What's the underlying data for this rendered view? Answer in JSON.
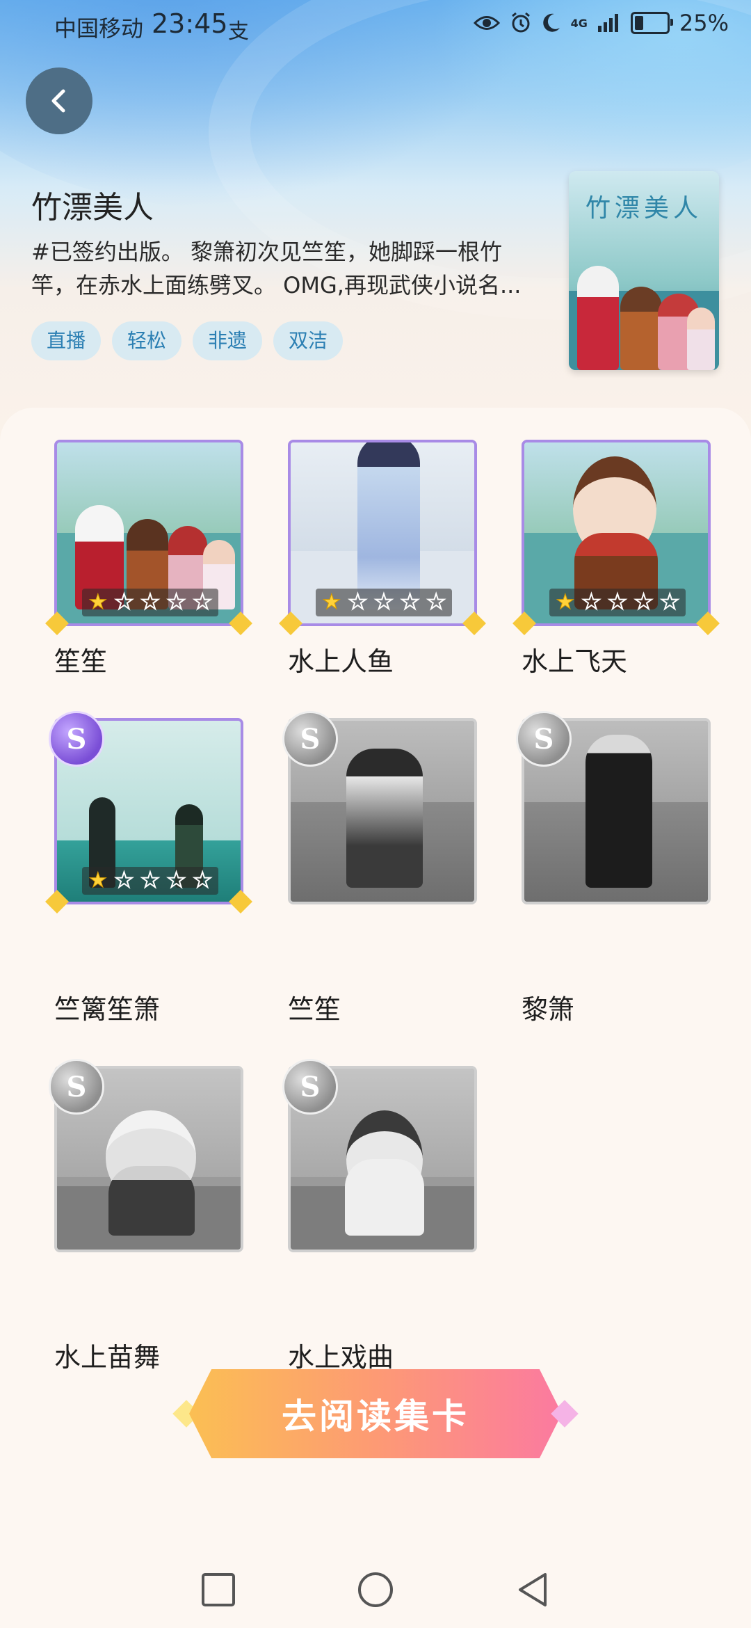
{
  "status_bar": {
    "carrier": "中国移动",
    "time": "23:45",
    "extra": "支",
    "network": "4G",
    "battery": "25%"
  },
  "book": {
    "title": "竹漂美人",
    "description_line1": "#已签约出版。 黎箫初次见竺笙，她脚踩一根竹",
    "description_line2": "竿，在赤水上面练劈叉。 OMG,再现武侠小说名...",
    "tags": [
      "直播",
      "轻松",
      "非遗",
      "双洁"
    ],
    "cover_title": "竹漂美人"
  },
  "cards": [
    {
      "name": "笙笙",
      "stars": 1,
      "collected": true
    },
    {
      "name": "水上人鱼",
      "stars": 1,
      "collected": true
    },
    {
      "name": "水上飞天",
      "stars": 1,
      "collected": true
    },
    {
      "name": "竺篱笙箫",
      "stars": 1,
      "collected": true,
      "rarity": "S"
    },
    {
      "name": "竺笙",
      "collected": false,
      "rarity": "S"
    },
    {
      "name": "黎箫",
      "collected": false,
      "rarity": "S"
    },
    {
      "name": "水上苗舞",
      "collected": false,
      "rarity": "S"
    },
    {
      "name": "水上戏曲",
      "collected": false,
      "rarity": "S"
    }
  ],
  "cta": {
    "label": "去阅读集卡"
  },
  "colors": {
    "accent_blue": "#2b7fb3",
    "card_purple": "#a88be6",
    "cta_start": "#fbbf53",
    "cta_end": "#fb7aa0"
  },
  "icons": {
    "back": "chevron-left-icon",
    "eye": "eye-icon",
    "alarm": "alarm-icon",
    "moon": "moon-icon"
  }
}
